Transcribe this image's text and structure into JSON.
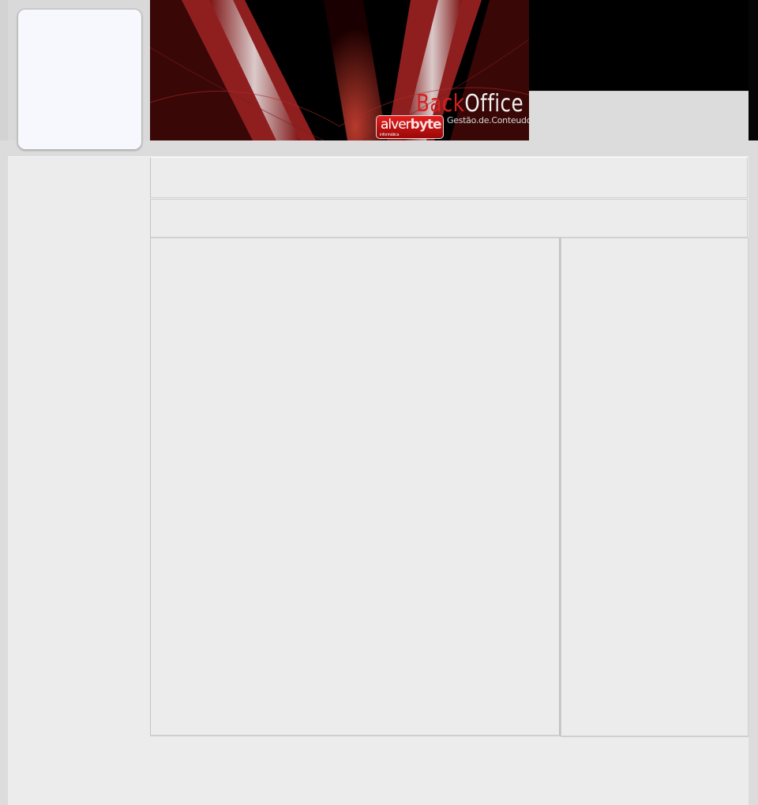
{
  "header": {
    "brand_part1": "Back",
    "brand_part2": "Office",
    "tagline": "Gestão.de.Conteudos",
    "company_name_part1": "alver",
    "company_name_part2": "byte",
    "company_sub": "informática"
  },
  "colors": {
    "accent_red": "#d62020",
    "panel_bg": "#ececec",
    "page_bg": "#dcdcdc"
  }
}
